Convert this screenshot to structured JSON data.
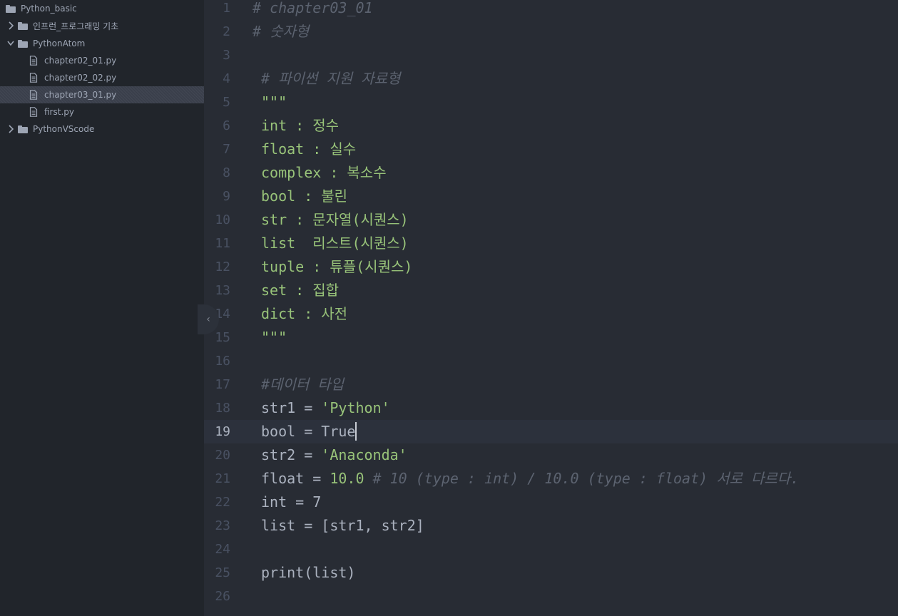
{
  "sidebar": {
    "items": [
      {
        "label": "Python_basic",
        "type": "folder",
        "expanded": true,
        "depth": 0,
        "selected": false
      },
      {
        "label": "인프런_프로그래밍 기초",
        "type": "folder",
        "expanded": false,
        "depth": 1,
        "selected": false
      },
      {
        "label": "PythonAtom",
        "type": "folder",
        "expanded": true,
        "depth": 1,
        "selected": false
      },
      {
        "label": "chapter02_01.py",
        "type": "file",
        "depth": 2,
        "selected": false
      },
      {
        "label": "chapter02_02.py",
        "type": "file",
        "depth": 2,
        "selected": false
      },
      {
        "label": "chapter03_01.py",
        "type": "file",
        "depth": 2,
        "selected": true
      },
      {
        "label": "first.py",
        "type": "file",
        "depth": 2,
        "selected": false
      },
      {
        "label": "PythonVScode",
        "type": "folder",
        "expanded": false,
        "depth": 1,
        "selected": false
      }
    ]
  },
  "editor": {
    "cursor_line": 19,
    "lines": [
      {
        "n": "1",
        "parts": [
          {
            "t": "# chapter03_01",
            "c": "cm"
          }
        ]
      },
      {
        "n": "2",
        "parts": [
          {
            "t": "# 숫자형",
            "c": "cm"
          }
        ]
      },
      {
        "n": "3",
        "parts": []
      },
      {
        "n": "4",
        "parts": [
          {
            "t": "# 파이썬 지원 자료형",
            "c": "cm"
          }
        ]
      },
      {
        "n": "5",
        "parts": [
          {
            "t": "\"\"\"",
            "c": "str"
          }
        ]
      },
      {
        "n": "6",
        "parts": [
          {
            "t": "int : 정수",
            "c": "str"
          }
        ]
      },
      {
        "n": "7",
        "parts": [
          {
            "t": "float : 실수",
            "c": "str"
          }
        ]
      },
      {
        "n": "8",
        "parts": [
          {
            "t": "complex : 복소수",
            "c": "str"
          }
        ]
      },
      {
        "n": "9",
        "parts": [
          {
            "t": "bool : 불린",
            "c": "str"
          }
        ]
      },
      {
        "n": "10",
        "parts": [
          {
            "t": "str : 문자열(시퀀스)",
            "c": "str"
          }
        ]
      },
      {
        "n": "11",
        "parts": [
          {
            "t": "list  리스트(시퀀스)",
            "c": "str"
          }
        ]
      },
      {
        "n": "12",
        "parts": [
          {
            "t": "tuple : 튜플(시퀀스)",
            "c": "str"
          }
        ]
      },
      {
        "n": "13",
        "parts": [
          {
            "t": "set : 집합",
            "c": "str"
          }
        ]
      },
      {
        "n": "14",
        "parts": [
          {
            "t": "dict : 사전",
            "c": "str"
          }
        ]
      },
      {
        "n": "15",
        "parts": [
          {
            "t": "\"\"\"",
            "c": "str"
          }
        ]
      },
      {
        "n": "16",
        "parts": []
      },
      {
        "n": "17",
        "parts": [
          {
            "t": "#데이터 타입",
            "c": "cm"
          }
        ]
      },
      {
        "n": "18",
        "parts": [
          {
            "t": "str1 = ",
            "c": "pl"
          },
          {
            "t": "'Python'",
            "c": "str"
          }
        ]
      },
      {
        "n": "19",
        "parts": [
          {
            "t": "bool = ",
            "c": "pl"
          },
          {
            "t": "True",
            "c": "pl"
          }
        ]
      },
      {
        "n": "20",
        "parts": [
          {
            "t": "str2 = ",
            "c": "pl"
          },
          {
            "t": "'Anaconda'",
            "c": "str"
          }
        ]
      },
      {
        "n": "21",
        "parts": [
          {
            "t": "float = ",
            "c": "pl"
          },
          {
            "t": "10.0",
            "c": "num"
          },
          {
            "t": " ",
            "c": "pl"
          },
          {
            "t": "# 10 (type : int) / 10.0 (type : float) 서로 다르다.",
            "c": "cm"
          }
        ]
      },
      {
        "n": "22",
        "parts": [
          {
            "t": "int = 7",
            "c": "pl"
          }
        ]
      },
      {
        "n": "23",
        "parts": [
          {
            "t": "list = [str1, str2]",
            "c": "pl"
          }
        ]
      },
      {
        "n": "24",
        "parts": []
      },
      {
        "n": "25",
        "parts": [
          {
            "t": "print(list)",
            "c": "pl"
          }
        ]
      },
      {
        "n": "26",
        "parts": []
      }
    ]
  },
  "collapse_handle": {
    "glyph": "‹"
  },
  "colors": {
    "comment": "#5c6370",
    "string": "#98c379",
    "plain": "#abb2bf",
    "gutter": "#495162"
  }
}
